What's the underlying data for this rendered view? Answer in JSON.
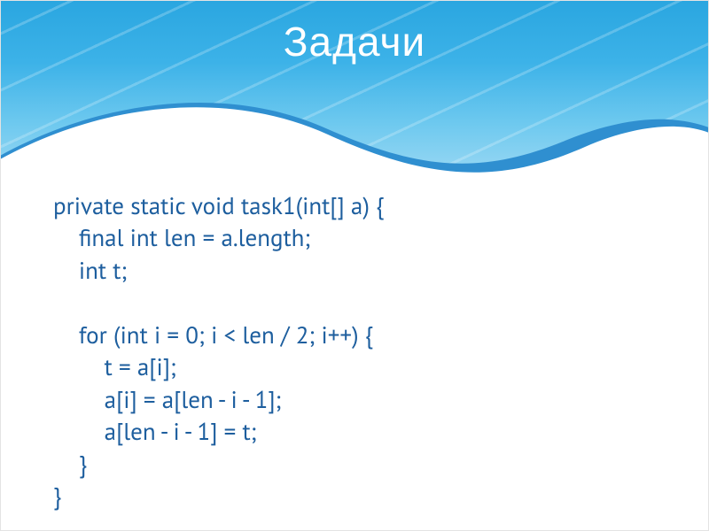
{
  "slide": {
    "title": "Задачи",
    "code": {
      "l1": "private static void task1(int[] a) {",
      "l2": "    final int len = a.length;",
      "l3": "    int t;",
      "l4": "",
      "l5": "    for (int i = 0; i < len / 2; i++) {",
      "l6": "        t = a[i];",
      "l7": "        a[i] = a[len - i - 1];",
      "l8": "        a[len - i - 1] = t;",
      "l9": "    }",
      "l10": "}"
    }
  }
}
